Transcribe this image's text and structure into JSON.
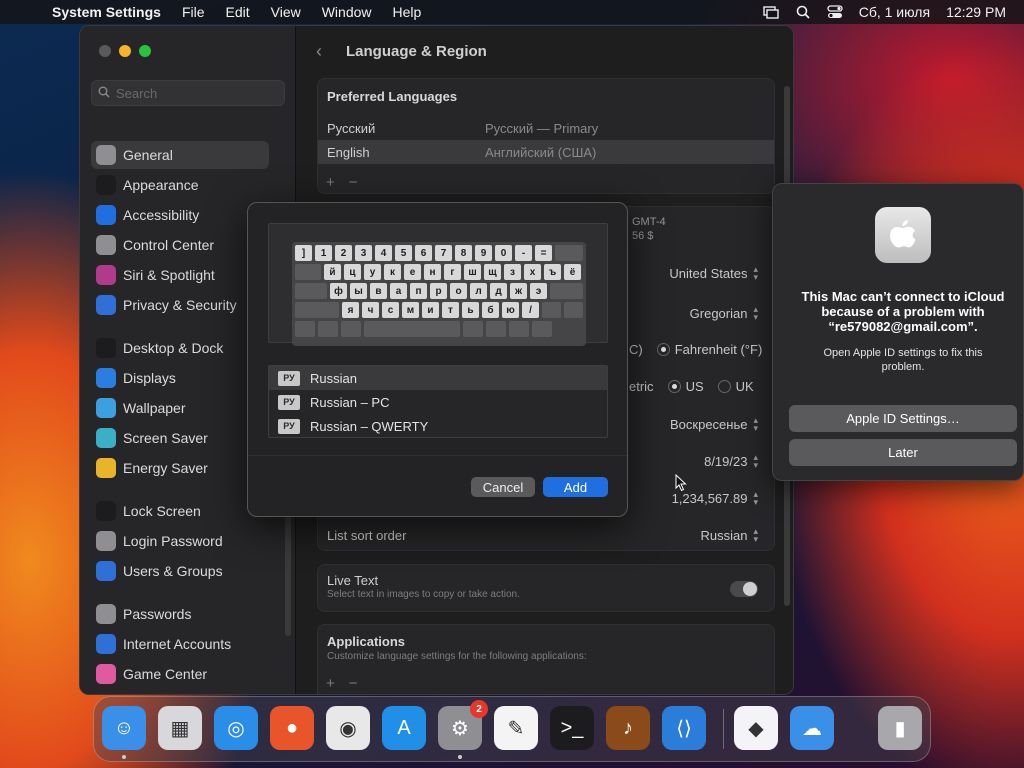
{
  "menubar": {
    "app": "System Settings",
    "items": [
      "File",
      "Edit",
      "View",
      "Window",
      "Help"
    ],
    "date": "Сб, 1 июля",
    "time": "12:29 PM"
  },
  "sidebar": {
    "search_placeholder": "Search",
    "items": [
      {
        "label": "General",
        "icon": "gear-icon",
        "color": "#8e8e93"
      },
      {
        "label": "Appearance",
        "icon": "appearance-icon",
        "color": "#1c1c1e"
      },
      {
        "label": "Accessibility",
        "icon": "accessibility-icon",
        "color": "#1f6fe0"
      },
      {
        "label": "Control Center",
        "icon": "control-center-icon",
        "color": "#8e8e93"
      },
      {
        "label": "Siri & Spotlight",
        "icon": "siri-icon",
        "color": "#b03a8c"
      },
      {
        "label": "Privacy & Security",
        "icon": "hand-icon",
        "color": "#2f6fd8"
      },
      {
        "label": "Desktop & Dock",
        "icon": "desktop-icon",
        "color": "#1c1c1e"
      },
      {
        "label": "Displays",
        "icon": "displays-icon",
        "color": "#2a7de1"
      },
      {
        "label": "Wallpaper",
        "icon": "wallpaper-icon",
        "color": "#3aa0e0"
      },
      {
        "label": "Screen Saver",
        "icon": "screen-saver-icon",
        "color": "#3ab0c8"
      },
      {
        "label": "Energy Saver",
        "icon": "bulb-icon",
        "color": "#e8b52a"
      },
      {
        "label": "Lock Screen",
        "icon": "lock-icon",
        "color": "#1c1c1e"
      },
      {
        "label": "Login Password",
        "icon": "login-icon",
        "color": "#8e8e93"
      },
      {
        "label": "Users & Groups",
        "icon": "users-icon",
        "color": "#2f6fd8"
      },
      {
        "label": "Passwords",
        "icon": "key-icon",
        "color": "#8e8e93"
      },
      {
        "label": "Internet Accounts",
        "icon": "at-icon",
        "color": "#2f6fd8"
      },
      {
        "label": "Game Center",
        "icon": "game-center-icon",
        "color": "#e05aa0"
      }
    ]
  },
  "content": {
    "title": "Language & Region",
    "preferred": {
      "header": "Preferred Languages",
      "langs": [
        {
          "name": "Русский",
          "detail": "Русский — Primary"
        },
        {
          "name": "English",
          "detail": "Английский (США)"
        }
      ],
      "plus": "+",
      "minus": "−"
    },
    "partial_tz": "GMT-4",
    "partial_price": "56 $",
    "region": "United States",
    "calendar": "Gregorian",
    "temp_c": "C)",
    "temp_f": "Fahrenheit (°F)",
    "measure_label": "etric",
    "measure_us": "US",
    "measure_uk": "UK",
    "first_day": "Воскресенье",
    "date_format": "8/19/23",
    "number_format": "1,234,567.89",
    "sort_label": "List sort order",
    "sort_value": "Russian",
    "live_text_title": "Live Text",
    "live_text_desc": "Select text in images to copy or take action.",
    "apps_title": "Applications",
    "apps_desc": "Customize language settings for the following applications:",
    "apps_plus": "+",
    "apps_minus": "−"
  },
  "dialog": {
    "keyboard_rows": [
      [
        "]",
        "1",
        "2",
        "3",
        "4",
        "5",
        "6",
        "7",
        "8",
        "9",
        "0",
        "-",
        "="
      ],
      [
        "й",
        "ц",
        "у",
        "к",
        "е",
        "н",
        "г",
        "ш",
        "щ",
        "з",
        "х",
        "ъ",
        "ё"
      ],
      [
        "ф",
        "ы",
        "в",
        "а",
        "п",
        "р",
        "о",
        "л",
        "д",
        "ж",
        "э"
      ],
      [
        "я",
        "ч",
        "с",
        "м",
        "и",
        "т",
        "ь",
        "б",
        "ю",
        "/"
      ]
    ],
    "layouts": [
      {
        "badge": "РУ",
        "name": "Russian"
      },
      {
        "badge": "РУ",
        "name": "Russian – PC"
      },
      {
        "badge": "РУ",
        "name": "Russian – QWERTY"
      }
    ],
    "cancel": "Cancel",
    "add": "Add"
  },
  "notice": {
    "title": "This Mac can’t connect to iCloud because of a problem with “re579082@gmail.com”.",
    "subtitle": "Open Apple ID settings to fix this problem.",
    "primary": "Apple ID Settings…",
    "secondary": "Later"
  },
  "dock": {
    "settings_badge": "2",
    "apps": [
      {
        "name": "finder-icon",
        "color": "#3a8fe8"
      },
      {
        "name": "launchpad-icon",
        "color": "#d8d8dc"
      },
      {
        "name": "safari-icon",
        "color": "#2a8ee8"
      },
      {
        "name": "firefox-icon",
        "color": "#e8552a"
      },
      {
        "name": "chrome-icon",
        "color": "#e8e8e8"
      },
      {
        "name": "app-store-icon",
        "color": "#1f8fe8"
      },
      {
        "name": "system-settings-icon",
        "color": "#8e8e93"
      },
      {
        "name": "textedit-icon",
        "color": "#f4f4f4"
      },
      {
        "name": "terminal-icon",
        "color": "#1c1c1e"
      },
      {
        "name": "garageband-icon",
        "color": "#8a4a1a"
      },
      {
        "name": "vscode-icon",
        "color": "#2a7dd8"
      },
      {
        "name": "visual-studio-icon",
        "color": "#f4f4f8"
      },
      {
        "name": "weather-icon",
        "color": "#3a8fe8"
      },
      {
        "name": "trash-icon",
        "color": "#a8a8ac"
      }
    ]
  }
}
